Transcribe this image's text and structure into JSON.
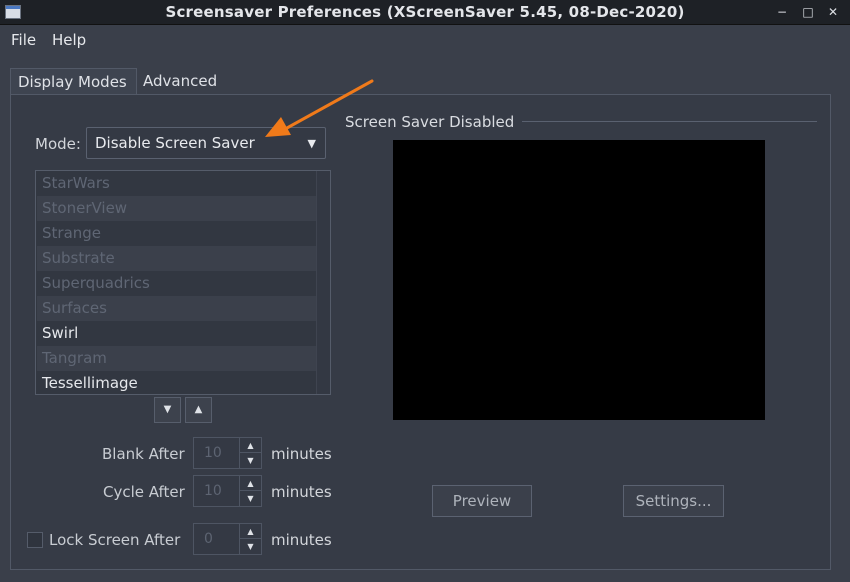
{
  "window": {
    "title": "Screensaver Preferences  (XScreenSaver 5.45, 08-Dec-2020)",
    "minimize_glyph": "−",
    "maximize_glyph": "□",
    "close_glyph": "✕"
  },
  "menu": {
    "file": "File",
    "help": "Help"
  },
  "tabs": {
    "display_modes": "Display Modes",
    "advanced": "Advanced"
  },
  "mode": {
    "label": "Mode:",
    "value": "Disable Screen Saver",
    "caret": "▼"
  },
  "list": {
    "items": [
      {
        "label": "StarWars",
        "enabled": false
      },
      {
        "label": "StonerView",
        "enabled": false
      },
      {
        "label": "Strange",
        "enabled": false
      },
      {
        "label": "Substrate",
        "enabled": false
      },
      {
        "label": "Superquadrics",
        "enabled": false
      },
      {
        "label": "Surfaces",
        "enabled": false
      },
      {
        "label": "Swirl",
        "enabled": true
      },
      {
        "label": "Tangram",
        "enabled": false
      },
      {
        "label": "Tessellimage",
        "enabled": true
      }
    ],
    "down_glyph": "▼",
    "up_glyph": "▲"
  },
  "timing": {
    "blank_label": "Blank After",
    "blank_value": "10",
    "cycle_label": "Cycle After",
    "cycle_value": "10",
    "lock_label": "Lock Screen After",
    "lock_value": "0",
    "unit": "minutes",
    "spin_up": "▲",
    "spin_down": "▼"
  },
  "preview": {
    "section_title": "Screen Saver Disabled",
    "preview_button": "Preview",
    "settings_button": "Settings..."
  },
  "colors": {
    "background": "#3a3f4a",
    "titlebar": "#1e2126",
    "preview_area": "#000000",
    "annotation_arrow": "#f07a1a"
  }
}
